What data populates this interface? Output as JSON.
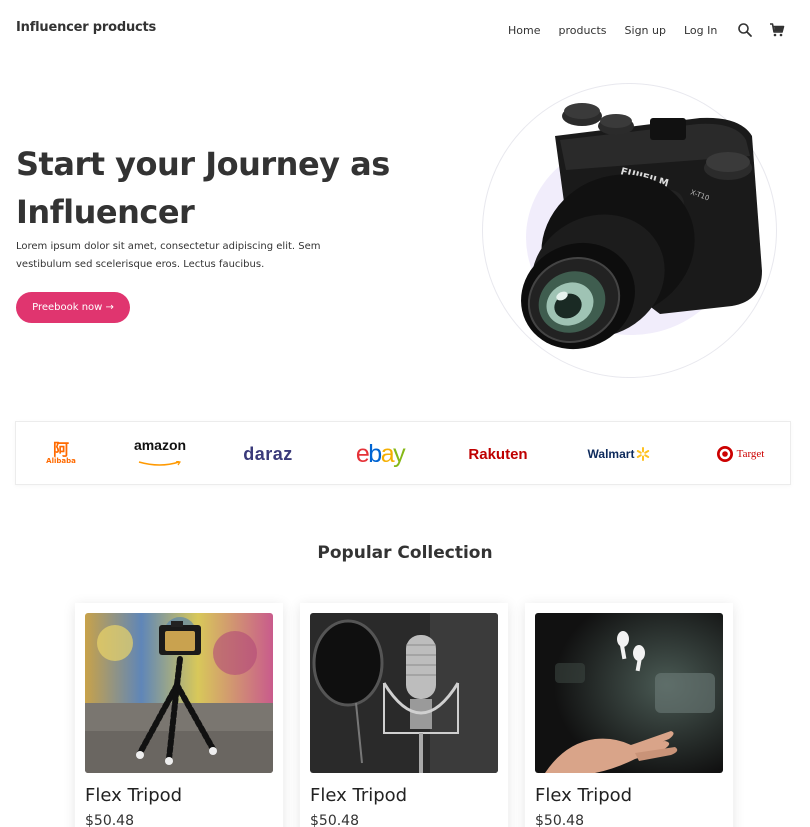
{
  "header": {
    "brand": "Influencer products",
    "nav": [
      {
        "label": "Home"
      },
      {
        "label": "products"
      },
      {
        "label": "Sign up"
      },
      {
        "label": "Log In"
      }
    ],
    "icons": [
      "search-icon",
      "cart-icon"
    ]
  },
  "hero": {
    "title": "Start your Journey as Influencer",
    "description": "Lorem ipsum dolor sit amet, consectetur adipiscing elit. Sem vestibulum sed scelerisque eros. Lectus faucibus.",
    "cta_label": "Preebook now →",
    "camera_brand": "FUJIFILM",
    "camera_model": "X-T10"
  },
  "brands": [
    "Alibaba",
    "amazon",
    "daraz",
    "ebay",
    "Rakuten",
    "Walmart",
    "Target"
  ],
  "collection": {
    "title": "Popular Collection",
    "products": [
      {
        "name": "Flex Tripod",
        "price": "$50.48",
        "image": "tripod-photo"
      },
      {
        "name": "Flex Tripod",
        "price": "$50.48",
        "image": "microphone-photo"
      },
      {
        "name": "Flex Tripod",
        "price": "$50.48",
        "image": "earbuds-photo"
      }
    ]
  },
  "colors": {
    "accent": "#e0356f",
    "text": "#333333",
    "blob": "#f1edfb"
  }
}
